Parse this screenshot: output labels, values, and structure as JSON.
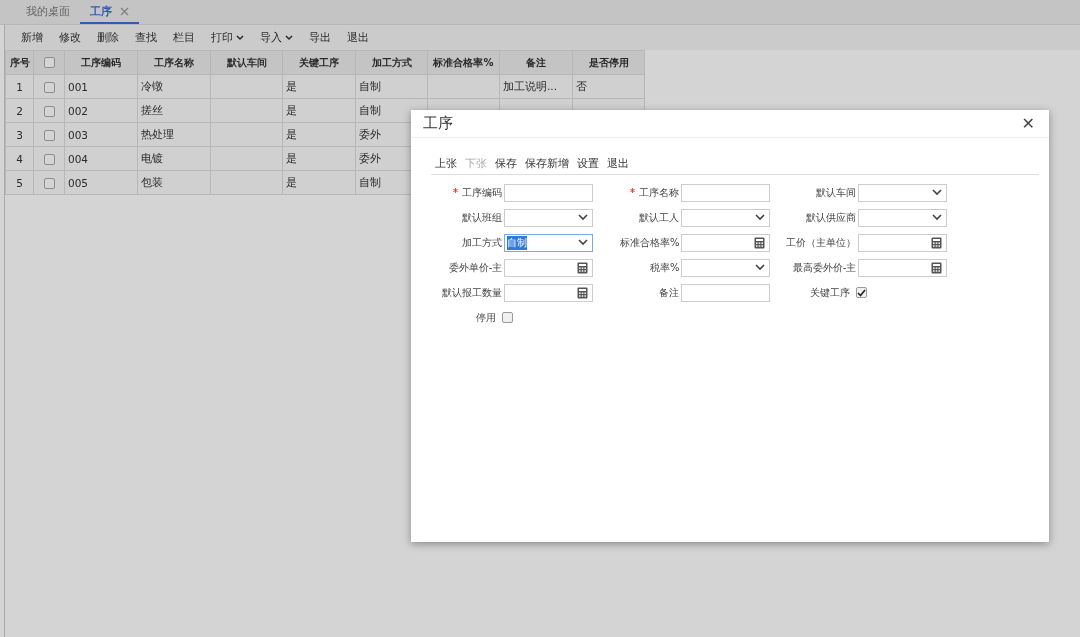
{
  "tabs": [
    {
      "label": "我的桌面",
      "selected": false,
      "closable": false
    },
    {
      "label": "工序",
      "selected": true,
      "closable": true
    }
  ],
  "toolbar": [
    {
      "label": "新增",
      "dropdown": false
    },
    {
      "label": "修改",
      "dropdown": false
    },
    {
      "label": "删除",
      "dropdown": false
    },
    {
      "label": "查找",
      "dropdown": false
    },
    {
      "label": "栏目",
      "dropdown": false
    },
    {
      "label": "打印",
      "dropdown": true
    },
    {
      "label": "导入",
      "dropdown": true
    },
    {
      "label": "导出",
      "dropdown": false
    },
    {
      "label": "退出",
      "dropdown": false
    }
  ],
  "table": {
    "select_all": {
      "checked": false
    },
    "columns": [
      "序号",
      "工序编码",
      "工序名称",
      "默认车间",
      "关键工序",
      "加工方式",
      "标准合格率%",
      "备注",
      "是否停用"
    ],
    "rows": [
      {
        "index": "1",
        "checked": false,
        "code": "001",
        "name": "冷镦",
        "workshop": "",
        "key": "是",
        "method": "自制",
        "rate": "",
        "remark": "加工说明...",
        "disabled": "否"
      },
      {
        "index": "2",
        "checked": false,
        "code": "002",
        "name": "搓丝",
        "workshop": "",
        "key": "是",
        "method": "自制"
      },
      {
        "index": "3",
        "checked": false,
        "code": "003",
        "name": "热处理",
        "workshop": "",
        "key": "是",
        "method": "委外"
      },
      {
        "index": "4",
        "checked": false,
        "code": "004",
        "name": "电镀",
        "workshop": "",
        "key": "是",
        "method": "委外"
      },
      {
        "index": "5",
        "checked": false,
        "code": "005",
        "name": "包装",
        "workshop": "",
        "key": "是",
        "method": "自制"
      }
    ]
  },
  "dialog": {
    "title": "工序",
    "close": "✕",
    "toolbar": [
      {
        "label": "上张",
        "disabled": false
      },
      {
        "label": "下张",
        "disabled": true
      },
      {
        "label": "保存",
        "disabled": false
      },
      {
        "label": "保存新增",
        "disabled": false
      },
      {
        "label": "设置",
        "disabled": false
      },
      {
        "label": "退出",
        "disabled": false
      }
    ],
    "fields": [
      {
        "label": "工序编码",
        "kind": "text",
        "required": true
      },
      {
        "label": "工序名称",
        "kind": "text",
        "required": true
      },
      {
        "label": "默认车间",
        "kind": "select",
        "required": false
      },
      {
        "label": "默认班组",
        "kind": "select",
        "required": false
      },
      {
        "label": "默认工人",
        "kind": "select",
        "required": false
      },
      {
        "label": "默认供应商",
        "kind": "select",
        "required": false
      },
      {
        "label": "加工方式",
        "kind": "select",
        "required": false,
        "value": "自制",
        "selected": true
      },
      {
        "label": "标准合格率%",
        "kind": "calc",
        "required": false
      },
      {
        "label": "工价（主单位）",
        "kind": "calc",
        "required": false
      },
      {
        "label": "委外单价-主",
        "kind": "calc",
        "required": false
      },
      {
        "label": "税率%",
        "kind": "select",
        "required": false
      },
      {
        "label": "最高委外价-主",
        "kind": "calc",
        "required": false
      },
      {
        "label": "默认报工数量",
        "kind": "calc",
        "required": false
      },
      {
        "label": "备注",
        "kind": "text",
        "required": false
      },
      {
        "label": "关键工序",
        "kind": "checkbox",
        "required": false,
        "checked": true
      },
      {
        "label": "停用",
        "kind": "checkbox",
        "required": false,
        "checked": false
      }
    ]
  }
}
